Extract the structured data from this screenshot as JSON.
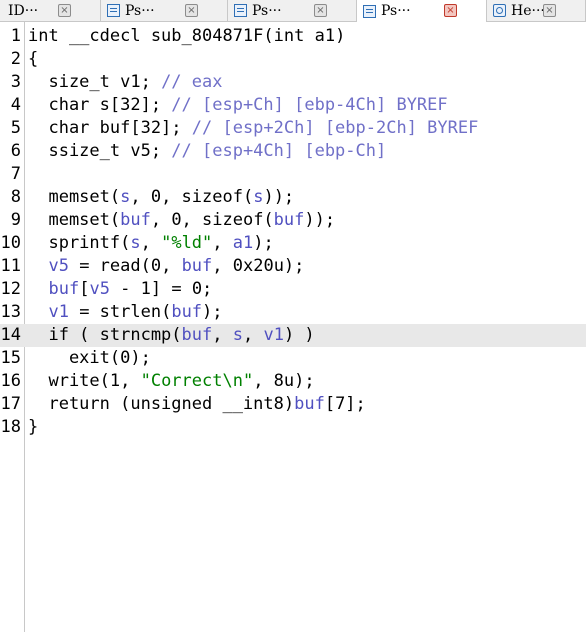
{
  "tabs": [
    {
      "label": "ID···",
      "icon": "none",
      "active": false
    },
    {
      "label": "Ps···",
      "icon": "pseudocode-icon",
      "active": false
    },
    {
      "label": "Ps···",
      "icon": "pseudocode-icon",
      "active": false
    },
    {
      "label": "Ps···",
      "icon": "pseudocode-icon",
      "active": true
    },
    {
      "label": "He···",
      "icon": "hex-view-icon",
      "active": false
    }
  ],
  "close_glyph": "×",
  "highlight_line": 14,
  "colors": {
    "variable": "#5050c0",
    "comment": "#7070c8",
    "string": "#008000",
    "highlight": "#e8e8e8"
  },
  "code": [
    {
      "n": "1",
      "tokens": [
        [
          "id",
          "int __cdecl sub_804871F("
        ],
        [
          "id",
          "int a1"
        ],
        [
          "punc",
          ")"
        ]
      ]
    },
    {
      "n": "2",
      "tokens": [
        [
          "punc",
          "{"
        ]
      ]
    },
    {
      "n": "3",
      "tokens": [
        [
          "id",
          "  size_t v1; "
        ],
        [
          "cmt",
          "// eax"
        ]
      ]
    },
    {
      "n": "4",
      "tokens": [
        [
          "id",
          "  char s[32]; "
        ],
        [
          "cmt",
          "// [esp+Ch] [ebp-4Ch] BYREF"
        ]
      ]
    },
    {
      "n": "5",
      "tokens": [
        [
          "id",
          "  char buf[32]; "
        ],
        [
          "cmt",
          "// [esp+2Ch] [ebp-2Ch] BYREF"
        ]
      ]
    },
    {
      "n": "6",
      "tokens": [
        [
          "id",
          "  ssize_t v5; "
        ],
        [
          "cmt",
          "// [esp+4Ch] [ebp-Ch]"
        ]
      ]
    },
    {
      "n": "7",
      "tokens": []
    },
    {
      "n": "8",
      "tokens": [
        [
          "id",
          "  memset("
        ],
        [
          "var",
          "s"
        ],
        [
          "id",
          ", 0, sizeof("
        ],
        [
          "var",
          "s"
        ],
        [
          "id",
          "));"
        ]
      ]
    },
    {
      "n": "9",
      "tokens": [
        [
          "id",
          "  memset("
        ],
        [
          "var",
          "buf"
        ],
        [
          "id",
          ", 0, sizeof("
        ],
        [
          "var",
          "buf"
        ],
        [
          "id",
          "));"
        ]
      ]
    },
    {
      "n": "10",
      "tokens": [
        [
          "id",
          "  sprintf("
        ],
        [
          "var",
          "s"
        ],
        [
          "id",
          ", "
        ],
        [
          "str",
          "\"%ld\""
        ],
        [
          "id",
          ", "
        ],
        [
          "var",
          "a1"
        ],
        [
          "id",
          ");"
        ]
      ]
    },
    {
      "n": "11",
      "tokens": [
        [
          "id",
          "  "
        ],
        [
          "var",
          "v5"
        ],
        [
          "id",
          " = read(0, "
        ],
        [
          "var",
          "buf"
        ],
        [
          "id",
          ", 0x20u);"
        ]
      ]
    },
    {
      "n": "12",
      "tokens": [
        [
          "id",
          "  "
        ],
        [
          "var",
          "buf"
        ],
        [
          "id",
          "["
        ],
        [
          "var",
          "v5"
        ],
        [
          "id",
          " - 1] = 0;"
        ]
      ]
    },
    {
      "n": "13",
      "tokens": [
        [
          "id",
          "  "
        ],
        [
          "var",
          "v1"
        ],
        [
          "id",
          " = strlen("
        ],
        [
          "var",
          "buf"
        ],
        [
          "id",
          ");"
        ]
      ]
    },
    {
      "n": "14",
      "tokens": [
        [
          "id",
          "  if ( strncmp("
        ],
        [
          "var",
          "buf"
        ],
        [
          "id",
          ", "
        ],
        [
          "var",
          "s"
        ],
        [
          "id",
          ", "
        ],
        [
          "var",
          "v1"
        ],
        [
          "id",
          ") )"
        ]
      ]
    },
    {
      "n": "15",
      "tokens": [
        [
          "id",
          "    exit(0);"
        ]
      ]
    },
    {
      "n": "16",
      "tokens": [
        [
          "id",
          "  write(1, "
        ],
        [
          "str",
          "\"Correct\\n\""
        ],
        [
          "id",
          ", 8u);"
        ]
      ]
    },
    {
      "n": "17",
      "tokens": [
        [
          "id",
          "  return (unsigned __int8)"
        ],
        [
          "var",
          "buf"
        ],
        [
          "id",
          "[7];"
        ]
      ]
    },
    {
      "n": "18",
      "tokens": [
        [
          "punc",
          "}"
        ]
      ]
    }
  ]
}
